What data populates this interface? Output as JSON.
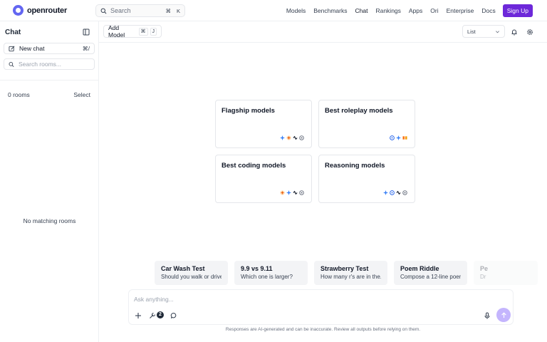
{
  "brand": {
    "name": "openrouter",
    "accent": "#6d28d9",
    "logo_color": "#6366f1"
  },
  "search": {
    "placeholder": "Search",
    "shortcut_symbol": "⌘",
    "shortcut_key": "K"
  },
  "nav": {
    "items": [
      "Models",
      "Benchmarks",
      "Chat",
      "Rankings",
      "Apps",
      "Ori",
      "Enterprise",
      "Docs"
    ],
    "active": "Chat",
    "signup_label": "Sign Up"
  },
  "sidebar": {
    "title": "Chat",
    "new_chat_label": "New chat",
    "new_chat_shortcut": "⌘/",
    "search_placeholder": "Search rooms...",
    "rooms_count": "0 rooms",
    "select_label": "Select",
    "empty_message": "No matching rooms"
  },
  "toolbar": {
    "add_model_label": "Add Model",
    "add_model_shortcut_symbol": "⌘",
    "add_model_shortcut_key": "J",
    "view_label": "List"
  },
  "cards": [
    {
      "title": "Flagship models",
      "icons": [
        "blue-spark-icon",
        "orange-starburst-icon",
        "black-knot-icon",
        "grey-globe-icon"
      ]
    },
    {
      "title": "Best roleplay models",
      "icons": [
        "blue-spark-icon",
        "blue-star-icon",
        "orange-m-icon"
      ]
    },
    {
      "title": "Best coding models",
      "icons": [
        "orange-starburst-icon",
        "blue-spark-icon",
        "black-knot-icon",
        "grey-globe-icon"
      ]
    },
    {
      "title": "Reasoning models",
      "icons": [
        "blue-spark-icon",
        "blue-star-icon",
        "black-knot-icon",
        "grey-globe-icon"
      ]
    }
  ],
  "suggestions": [
    {
      "title": "Car Wash Test",
      "subtitle": "Should you walk or drive..."
    },
    {
      "title": "9.9 vs 9.11",
      "subtitle": "Which one is larger?"
    },
    {
      "title": "Strawberry Test",
      "subtitle": "How many r's are in the..."
    },
    {
      "title": "Poem Riddle",
      "subtitle": "Compose a 12-line poem..."
    },
    {
      "title": "Pe",
      "subtitle": "Dr"
    }
  ],
  "composer": {
    "placeholder": "Ask anything...",
    "tools_badge": "2",
    "disclaimer": "Responses are AI-generated and can be inaccurate. Review all outputs before relying on them."
  }
}
